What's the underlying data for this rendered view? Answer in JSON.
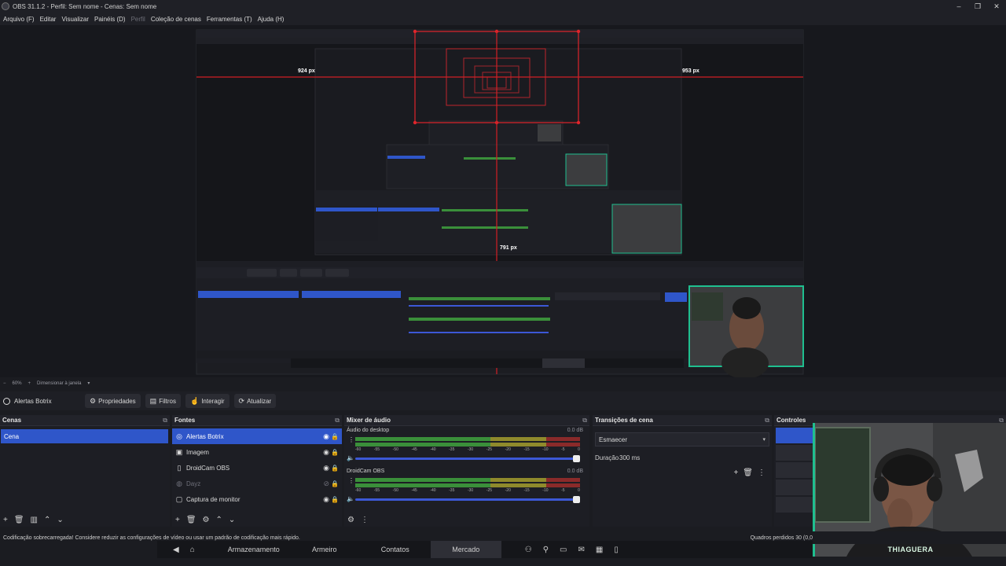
{
  "window": {
    "title": "OBS 31.1.2 - Perfil: Sem nome - Cenas: Sem nome",
    "controls": [
      "–",
      "❐",
      "✕"
    ]
  },
  "menu": [
    "Arquivo (F)",
    "Editar",
    "Visualizar",
    "Painéis (D)",
    "Perfil",
    "Coleção de cenas",
    "Ferramentas (T)",
    "Ajuda (H)"
  ],
  "preview": {
    "measure_left": "924 px",
    "measure_right": "953 px",
    "measure_mid": "791 px"
  },
  "zoom": {
    "value": "60%",
    "mode": "Dimensionar à janela"
  },
  "context": {
    "source_name": "Alertas Botrix",
    "buttons": [
      "Propriedades",
      "Filtros",
      "Interagir",
      "Atualizar"
    ]
  },
  "scenes": {
    "title": "Cenas",
    "items": [
      "Cena"
    ]
  },
  "sources": {
    "title": "Fontes",
    "items": [
      {
        "name": "Alertas Botrix",
        "icon": "globe-icon"
      },
      {
        "name": "Imagem",
        "icon": "image-icon"
      },
      {
        "name": "DroidCam OBS",
        "icon": "file-icon"
      },
      {
        "name": "Dayz",
        "icon": "gamepad-icon"
      },
      {
        "name": "Captura de monitor",
        "icon": "monitor-icon"
      }
    ]
  },
  "mixer": {
    "title": "Mixer de áudio",
    "channels": [
      {
        "name": "Áudio do desktop",
        "db": "0.0 dB"
      },
      {
        "name": "DroidCam OBS",
        "db": "0.0 dB"
      }
    ],
    "ticks": [
      "-60",
      "-55",
      "-50",
      "-45",
      "-40",
      "-35",
      "-30",
      "-25",
      "-20",
      "-15",
      "-10",
      "-5",
      "0"
    ]
  },
  "transitions": {
    "title": "Transições de cena",
    "selected": "Esmaecer",
    "duration_label": "Duração",
    "duration_value": "300 ms"
  },
  "controls": {
    "title": "Controles"
  },
  "webcam": {
    "label": "THIAGUERA"
  },
  "status": {
    "message": "Codificação sobrecarregada! Considere reduzir as configurações de vídeo ou usar um padrão de codificação mais rápido.",
    "frames": "Quadros perdidos 30 (0,0"
  },
  "hud": {
    "tabs": [
      "Armazenamento",
      "Armeiro",
      "Contatos",
      "Mercado"
    ],
    "active": "Mercado"
  }
}
